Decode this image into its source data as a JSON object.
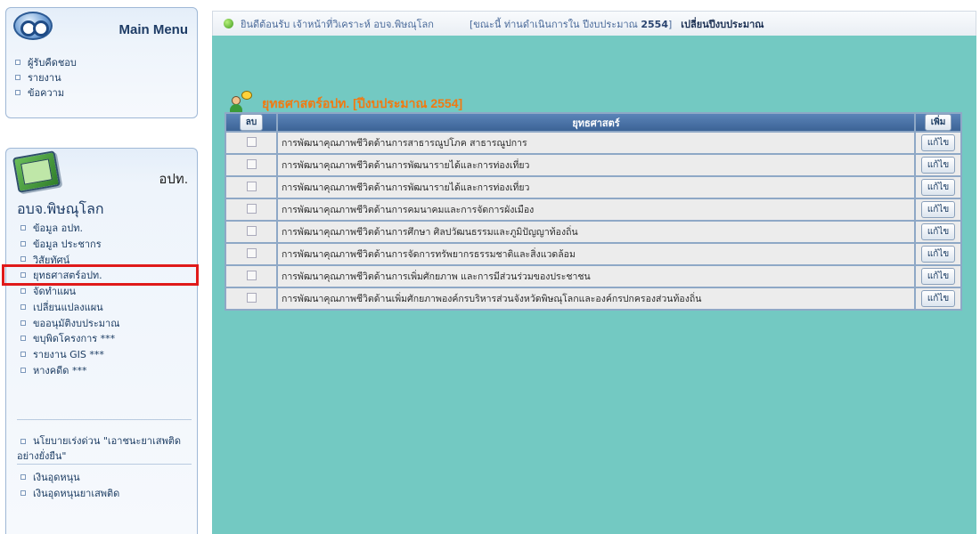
{
  "sidebar": {
    "main_menu": {
      "title": "Main Menu",
      "items": [
        "ผู้รับคืดชอบ",
        "รายงาน",
        "ข้อความ"
      ]
    },
    "org_box": {
      "title": "อปท.",
      "org_name": "อบจ.พิษณุโลก",
      "items": [
        "ข้อมูล อปท.",
        "ข้อมูล ประชากร",
        "วิสัยทัศน์",
        "ยุทธศาสตร์อปท.",
        "จัดทำแผน",
        "เปลี่ยนแปลงแผน",
        "ขออนุมัติงบประมาณ",
        "ขบุพิดโครงการ ***",
        "รายงาน GIS ***",
        "หางคดีด ***"
      ],
      "highlighted_index": 3,
      "policy": "นโยบายเร่งด่วน \"เอาชนะยาเสพติดอย่างยั่งยืน\"",
      "funds": [
        "เงินอุดหนุน",
        "เงินอุดหนุนยาเสพติด"
      ]
    }
  },
  "header": {
    "welcome": "ยินดีต้อนรับ เจ้าหน้าที่วิเคราะห์ อบจ.พิษณุโลก",
    "budget_note_prefix": "[ขณะนี้ ท่านดำเนินการใน ปีงบประมาณ",
    "budget_year": "2554",
    "budget_note_suffix": "]",
    "change_year": "เปลี่ยนปีงบประมาณ"
  },
  "panel": {
    "title": "ยุทธศาสตร์อปท. [ปีงบประมาณ 2554]",
    "table": {
      "col_delete": "ลบ",
      "col_strategy": "ยุทธศาสตร์",
      "col_add": "เพิ่ม",
      "edit_label": "แก้ไข",
      "rows": [
        "การพัฒนาคุณภาพชีวิตด้านการสาธารณูปโภค สาธารณูปการ",
        "การพัฒนาคุณภาพชีวิตด้านการพัฒนารายได้และการท่องเที่ยว",
        "การพัฒนาคุณภาพชีวิตด้านการพัฒนารายได้และการท่องเที่ยว",
        "การพัฒนาคุณภาพชีวิตด้านการคมนาคมและการจัดการผังเมือง",
        "การพัฒนาคุณภาพชีวิตด้านการศึกษา ศิลปวัฒนธรรมและภูมิปัญญาท้องถิ่น",
        "การพัฒนาคุณภาพชีวิตด้านการจัดการทรัพยากรธรรมชาติและสิ่งแวดล้อม",
        "การพัฒนาคุณภาพชีวิตด้านการเพิ่มศักยภาพ และการมีส่วนร่วมของประชาชน",
        "การพัฒนาคุณภาพชีวิตด้านเพิ่มศักยภาพองค์กรบริหารส่วนจังหวัดพิษณุโลกและองค์กรปกครองส่วนท้องถิ่น"
      ]
    }
  }
}
